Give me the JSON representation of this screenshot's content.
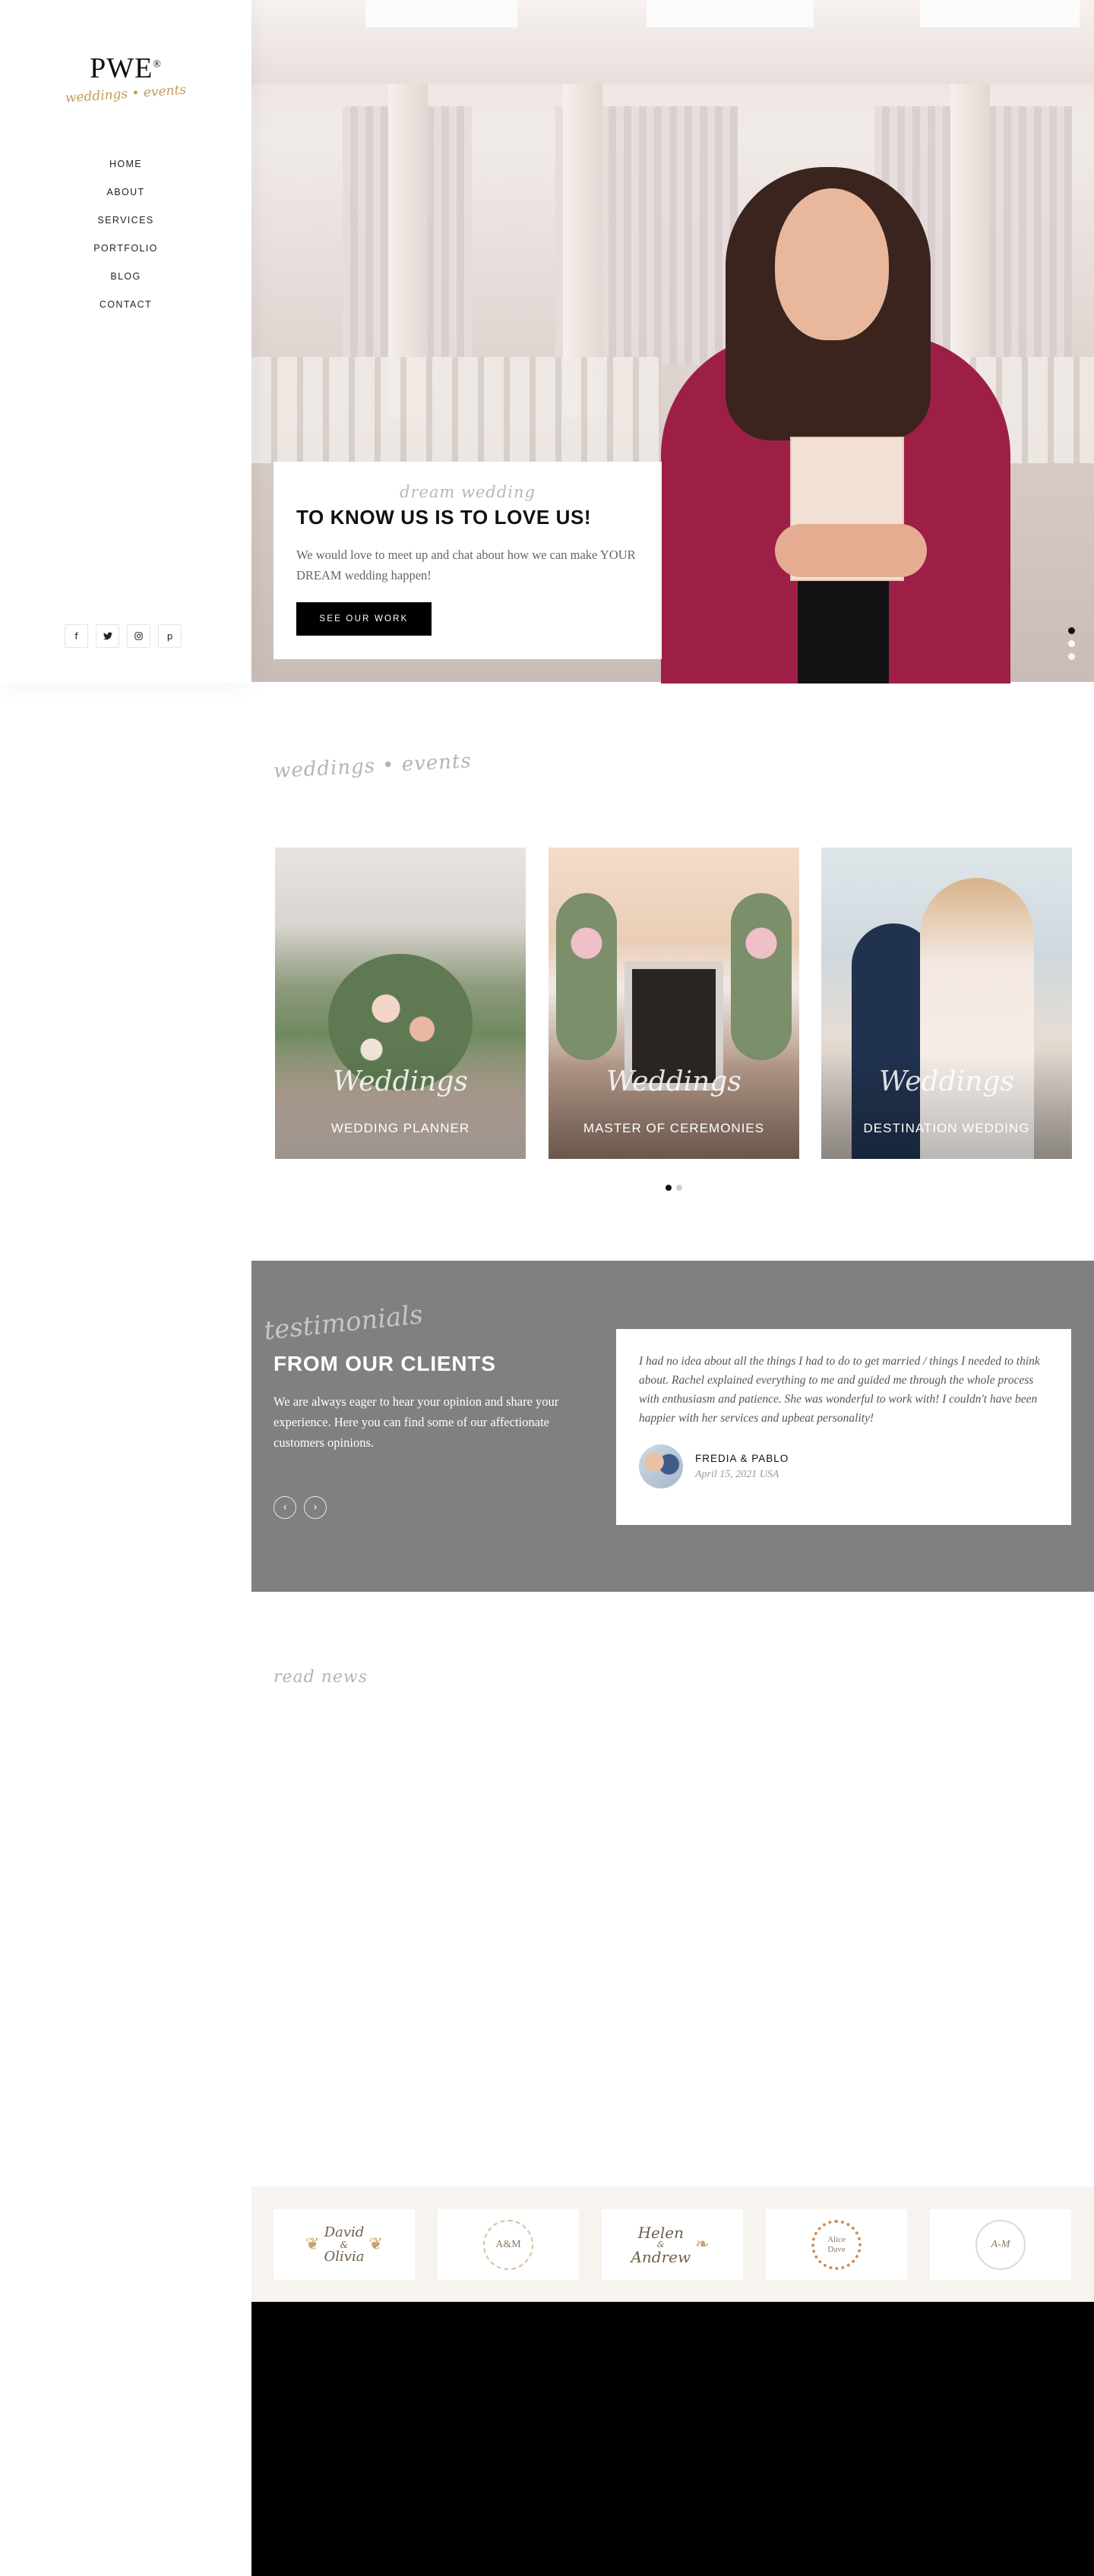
{
  "sidebar": {
    "logo_mark": "PWE",
    "logo_registered": "®",
    "logo_script": "weddings • events",
    "nav": [
      "HOME",
      "ABOUT",
      "SERVICES",
      "PORTFOLIO",
      "BLOG",
      "CONTACT"
    ],
    "social": [
      {
        "icon": "facebook-icon",
        "glyph": "f"
      },
      {
        "icon": "twitter-icon",
        "glyph": "🐦"
      },
      {
        "icon": "instagram-icon",
        "glyph": "◻"
      },
      {
        "icon": "pinterest-icon",
        "glyph": "p"
      }
    ]
  },
  "hero": {
    "script": "dream wedding",
    "title": "TO KNOW US IS TO LOVE US!",
    "text": "We would love to meet up and chat about how we can make YOUR DREAM wedding happen!",
    "button": "SEE OUR WORK",
    "slide_count": 3,
    "active_slide": 1
  },
  "weddings": {
    "script": "weddings • events",
    "cards": [
      {
        "script": "Weddings",
        "label": "WEDDING PLANNER"
      },
      {
        "script": "Weddings",
        "label": "MASTER OF CEREMONIES"
      },
      {
        "script": "Weddings",
        "label": "DESTINATION WEDDING"
      }
    ],
    "page_count": 2,
    "active_page": 1
  },
  "testimonials": {
    "script": "testimonials",
    "title": "FROM OUR CLIENTS",
    "text": "We are always eager to hear your opinion and share your experience. Here you can find some of our affectionate customers opinions.",
    "prev": "‹",
    "next": "›",
    "quote": "I had no idea about all the things I had to do to get married / things I needed to think about. Rachel explained everything to me and guided me through the whole process with enthusiasm and patience. She was wonderful to work with! I couldn't have been happier with her services and upbeat personality!",
    "author": "FREDIA & PABLO",
    "date": "April 15, 2021 USA"
  },
  "news": {
    "script": "read news"
  },
  "logos": [
    {
      "top": "David",
      "mid": "&",
      "bottom": "Olivia"
    },
    {
      "text": "A&M"
    },
    {
      "top": "Helen",
      "mid": "&",
      "bottom": "Andrew"
    },
    {
      "top": "Alice",
      "bottom": "Dave"
    },
    {
      "text": "A-M"
    }
  ],
  "colors": {
    "accent_gold": "#c59a5c",
    "testimonial_bg": "#808080",
    "footer_bg": "#000000",
    "logos_bg": "#f7f3ef"
  }
}
